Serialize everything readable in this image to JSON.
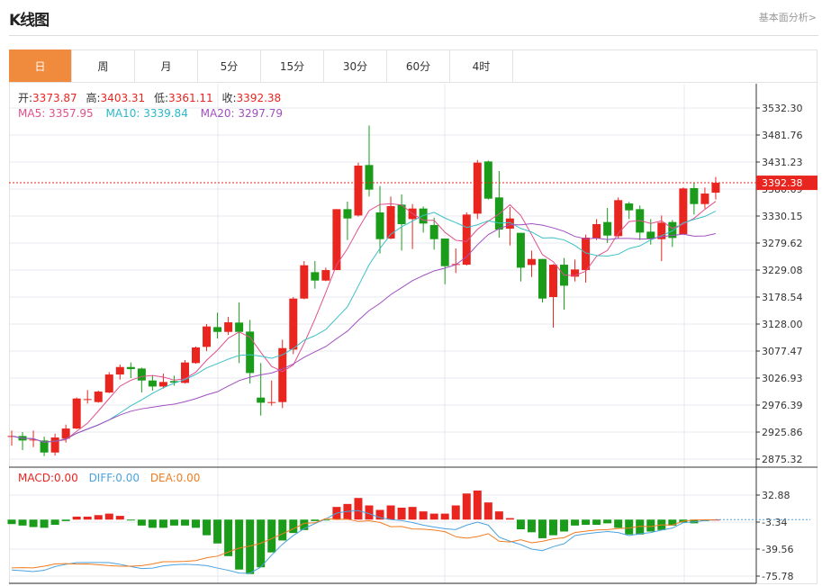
{
  "header": {
    "title": "K线图",
    "link": "基本面分析>"
  },
  "tabs": [
    {
      "label": "日",
      "active": true
    },
    {
      "label": "周"
    },
    {
      "label": "月"
    },
    {
      "label": "5分"
    },
    {
      "label": "15分"
    },
    {
      "label": "30分"
    },
    {
      "label": "60分"
    },
    {
      "label": "4时"
    }
  ],
  "ohlc": {
    "open_label": "开:",
    "open": "3373.87",
    "high_label": "高:",
    "high": "3403.31",
    "low_label": "低:",
    "low": "3361.11",
    "close_label": "收:",
    "close": "3392.38"
  },
  "ma": {
    "ma5": "MA5: 3357.95",
    "ma10": "MA10: 3339.84",
    "ma20": "MA20: 3297.79"
  },
  "macd_legend": {
    "macd": "MACD:0.00",
    "diff": "DIFF:0.00",
    "dea": "DEA:0.00"
  },
  "colors": {
    "up": "#e8251f",
    "down": "#1a9c1a",
    "ma5": "#e0508c",
    "ma10": "#3cc0c8",
    "ma20": "#a050c0",
    "diff": "#4aa3e0",
    "dea": "#f07c20",
    "accent": "#f08a3c"
  },
  "chart_data": [
    {
      "type": "candlestick",
      "last_price": "3392.38",
      "ylim": [
        2875.32,
        3532.3
      ],
      "y_ticks": [
        "3532.30",
        "3481.76",
        "3431.23",
        "3380.69",
        "3330.15",
        "3279.62",
        "3229.08",
        "3178.54",
        "3128.00",
        "3077.47",
        "3026.93",
        "2976.39",
        "2925.86",
        "2875.32"
      ],
      "grid": true,
      "series_ma": [
        "MA5",
        "MA10",
        "MA20"
      ],
      "ohlc": [
        [
          2918.0,
          2928.6,
          2900.5,
          2918.5
        ],
        [
          2918.5,
          2925.8,
          2892.1,
          2910.1
        ],
        [
          2911.5,
          2928.6,
          2897.7,
          2911.8
        ],
        [
          2910.1,
          2917.4,
          2880.9,
          2887.6
        ],
        [
          2887.6,
          2923.0,
          2882.0,
          2915.7
        ],
        [
          2913.4,
          2939.8,
          2906.1,
          2932.5
        ],
        [
          2932.5,
          2990.4,
          2931.4,
          2988.7
        ],
        [
          2987.0,
          3004.4,
          2979.1,
          2987.6
        ],
        [
          2982.0,
          3003.3,
          2980.8,
          3001.6
        ],
        [
          2999.9,
          3038.1,
          2998.8,
          3033.6
        ],
        [
          3033.6,
          3052.2,
          3024.0,
          3047.6
        ],
        [
          3047.6,
          3056.1,
          3026.9,
          3043.7
        ],
        [
          3044.8,
          3046.5,
          2999.9,
          3022.4
        ],
        [
          3022.4,
          3031.4,
          3003.3,
          3011.1
        ],
        [
          3011.1,
          3035.3,
          3007.2,
          3019.6
        ],
        [
          3021.3,
          3031.4,
          3012.8,
          3018.5
        ],
        [
          3017.9,
          3060.6,
          3016.7,
          3056.1
        ],
        [
          3055.0,
          3085.8,
          3053.8,
          3084.2
        ],
        [
          3085.3,
          3128.0,
          3077.4,
          3123.5
        ],
        [
          3122.3,
          3149.3,
          3101.0,
          3113.3
        ],
        [
          3113.3,
          3141.4,
          3107.7,
          3131.3
        ],
        [
          3130.8,
          3168.4,
          3055.0,
          3113.3
        ],
        [
          3113.9,
          3135.8,
          3016.7,
          3036.4
        ],
        [
          2990.4,
          3055.0,
          2956.7,
          2980.8
        ],
        [
          2981.5,
          3022.4,
          2975.2,
          2982.0
        ],
        [
          2982.0,
          3098.7,
          2970.7,
          3083.0
        ],
        [
          3080.2,
          3178.5,
          3071.8,
          3175.7
        ],
        [
          3175.7,
          3245.9,
          3174.5,
          3238.0
        ],
        [
          3225.1,
          3245.9,
          3194.2,
          3209.4
        ],
        [
          3209.4,
          3233.5,
          3208.3,
          3229.0
        ],
        [
          3229.0,
          3343.0,
          3229.0,
          3343.0
        ],
        [
          3343.0,
          3357.1,
          3285.2,
          3325.6
        ],
        [
          3331.2,
          3430.1,
          3329.0,
          3424.5
        ],
        [
          3425.6,
          3499.7,
          3366.6,
          3379.5
        ],
        [
          3336.9,
          3386.3,
          3259.9,
          3286.9
        ],
        [
          3288.0,
          3366.6,
          3286.9,
          3348.7
        ],
        [
          3351.5,
          3370.6,
          3265.5,
          3315.0
        ],
        [
          3324.5,
          3352.6,
          3268.4,
          3344.2
        ],
        [
          3344.2,
          3348.1,
          3299.2,
          3316.1
        ],
        [
          3313.3,
          3327.3,
          3267.2,
          3286.9
        ],
        [
          3288.0,
          3288.0,
          3202.6,
          3236.3
        ],
        [
          3239.5,
          3269.5,
          3223.4,
          3240.3
        ],
        [
          3239.1,
          3336.9,
          3237.5,
          3332.9
        ],
        [
          3334.6,
          3435.1,
          3324.5,
          3430.1
        ],
        [
          3432.3,
          3434.0,
          3361.0,
          3362.7
        ],
        [
          3365.0,
          3414.4,
          3289.7,
          3304.9
        ],
        [
          3306.5,
          3347.0,
          3275.1,
          3325.6
        ],
        [
          3298.7,
          3298.7,
          3207.7,
          3233.5
        ],
        [
          3238.6,
          3265.5,
          3216.1,
          3249.8
        ],
        [
          3249.8,
          3249.8,
          3168.4,
          3175.7
        ],
        [
          3178.5,
          3240.3,
          3121.2,
          3239.1
        ],
        [
          3239.1,
          3251.5,
          3154.9,
          3199.8
        ],
        [
          3216.7,
          3248.7,
          3207.7,
          3230.2
        ],
        [
          3229.0,
          3295.3,
          3205.5,
          3289.7
        ],
        [
          3288.0,
          3324.5,
          3285.2,
          3315.0
        ],
        [
          3318.9,
          3345.3,
          3279.6,
          3293.6
        ],
        [
          3292.5,
          3365.0,
          3288.0,
          3359.9
        ],
        [
          3353.7,
          3356.5,
          3324.5,
          3340.8
        ],
        [
          3343.0,
          3349.8,
          3285.2,
          3299.2
        ],
        [
          3300.9,
          3324.5,
          3276.8,
          3288.0
        ],
        [
          3286.9,
          3331.2,
          3245.9,
          3317.8
        ],
        [
          3318.9,
          3322.8,
          3272.3,
          3289.1
        ],
        [
          3296.4,
          3383.5,
          3295.3,
          3381.8
        ],
        [
          3382.4,
          3391.9,
          3332.9,
          3352.6
        ],
        [
          3352.6,
          3383.5,
          3344.2,
          3372.2
        ],
        [
          3373.87,
          3403.31,
          3361.11,
          3392.38
        ]
      ]
    },
    {
      "type": "bar+line",
      "ylim": [
        -75.78,
        32.88
      ],
      "y_ticks": [
        "32.88",
        "-3.34",
        "-39.56",
        "-75.78"
      ],
      "macd": [
        -6,
        -8,
        -10,
        -11,
        -7,
        -2,
        4,
        4,
        6,
        8,
        5,
        -1,
        -8,
        -11,
        -11,
        -8,
        -8,
        -11,
        -21,
        -32,
        -49,
        -67,
        -73,
        -64,
        -44,
        -28,
        -18,
        -14,
        -2,
        -1,
        17,
        21,
        29,
        19,
        13,
        19,
        16,
        17,
        11,
        8,
        8,
        19,
        35,
        39,
        23,
        11,
        2,
        -13,
        -17,
        -25,
        -21,
        -16,
        -8,
        -7,
        -7,
        -5,
        -11,
        -20,
        -20,
        -16,
        -14,
        -8,
        -4,
        -5,
        -2,
        0
      ],
      "diff": [
        -67.7,
        -68.5,
        -69.7,
        -68,
        -63,
        -60,
        -57.7,
        -57.5,
        -57.5,
        -57.7,
        -60,
        -63,
        -65.7,
        -65,
        -62,
        -60.5,
        -60,
        -60.5,
        -61.7,
        -65,
        -68,
        -71.7,
        -72,
        -63.7,
        -47.6,
        -33,
        -21.4,
        -12,
        -5.3,
        1,
        8.7,
        11,
        12,
        8,
        2.7,
        0,
        -1.3,
        -4,
        -7.4,
        -10,
        -12.2,
        -13.4,
        -7.4,
        -3.3,
        -7.4,
        -23.5,
        -29,
        -33.5,
        -39.6,
        -41.6,
        -36.3,
        -32.3,
        -21.4,
        -19,
        -17.4,
        -16,
        -17.4,
        -21.4,
        -19,
        -17.4,
        -14,
        -11.4,
        -4.1,
        -3,
        -1.3,
        -0.1
      ]
    }
  ]
}
